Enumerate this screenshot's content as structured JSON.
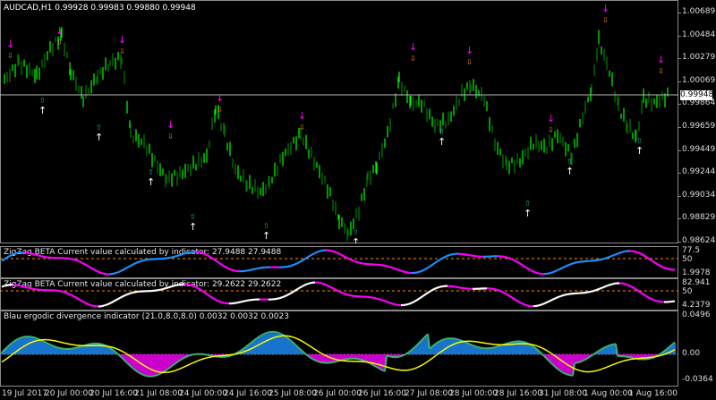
{
  "main": {
    "title": "AUDCAD,H1  0.99928 0.99983 0.99880 0.99948",
    "price_ticks": [
      "1.00689",
      "1.00484",
      "1.00279",
      "1.00069",
      "0.99864",
      "0.99659",
      "0.99449",
      "0.99244",
      "0.99034",
      "0.98829",
      "0.98624"
    ],
    "current_price": "0.99948",
    "colors": {
      "bull": "#00ff00",
      "bear": "#008000",
      "up_arrow": "#ffffff",
      "up_arrow_alt": "#00bfbf",
      "down_arrow": "#ff00ff",
      "down_arrow_alt": "#ff8c00"
    }
  },
  "zigzag1": {
    "label": "ZigZag BETA Current value calculated by indicator: 27.9488 27.9488",
    "ticks": [
      "77.5",
      "50",
      "1.9978"
    ],
    "colors": {
      "up": "#1e90ff",
      "down": "#ff00ff",
      "level": "#ff8c00"
    }
  },
  "zigzag2": {
    "label": "ZigZag BETA Current value calculated by indicator: 29.2622 29.2622",
    "ticks": [
      "82.941",
      "50",
      "4.2379"
    ],
    "colors": {
      "up": "#ffffff",
      "down": "#ff00ff",
      "level": "#ff8c00"
    }
  },
  "blau": {
    "label": "Blau ergodic divergence indicator (21.0,8.0,8.0) 0.0032 0.0032 0.0023",
    "ticks": [
      "0.0496",
      "0.00",
      "-0.0364"
    ],
    "colors": {
      "pos_hist": "#1e90ff",
      "neg_hist": "#ff00ff",
      "signal": "#ffff00",
      "main": "#3cb371"
    }
  },
  "time_axis": [
    "19 Jul 2017",
    "20 Jul 00:00",
    "20 Jul 16:00",
    "21 Jul 08:00",
    "24 Jul 00:00",
    "24 Jul 16:00",
    "25 Jul 08:00",
    "26 Jul 00:00",
    "26 Jul 16:00",
    "27 Jul 08:00",
    "28 Jul 00:00",
    "28 Jul 16:00",
    "31 Jul 08:00",
    "1 Aug 00:00",
    "1 Aug 16:00"
  ]
}
